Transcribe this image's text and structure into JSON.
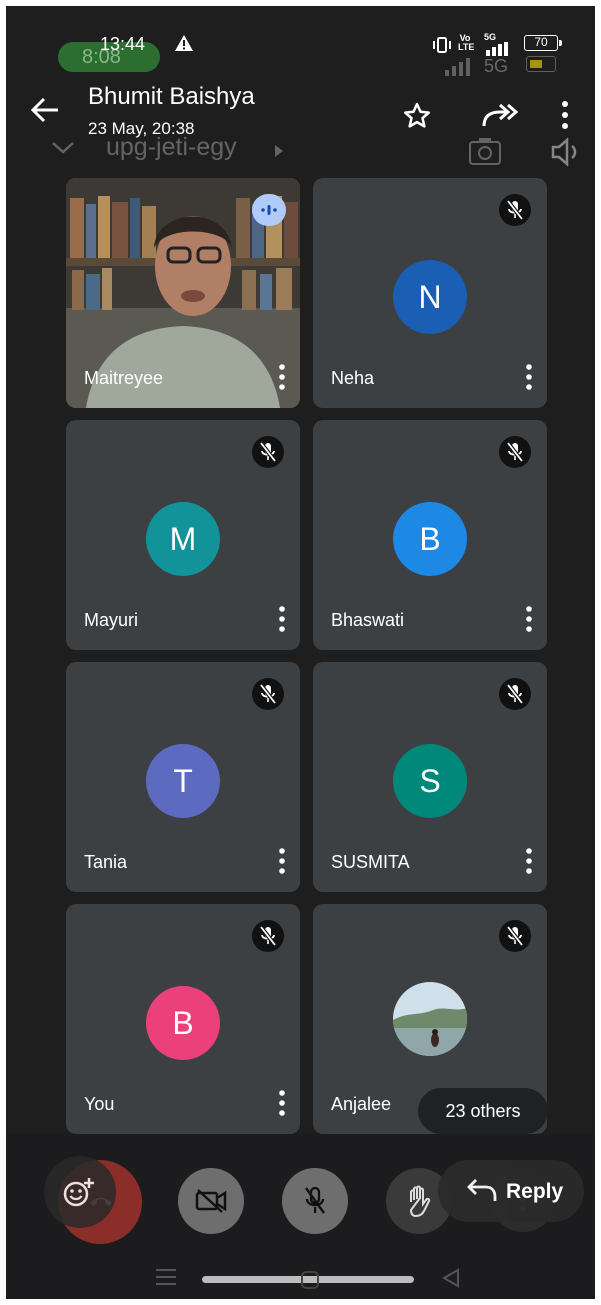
{
  "status_bar": {
    "time": "13:44",
    "battery": "70",
    "ghost_time": "8:08",
    "ghost_network": "5G",
    "volte": "Vo LTE",
    "network": "5G"
  },
  "header": {
    "title": "Bhumit Baishya",
    "subtitle": "23 May, 20:38",
    "ghost_meeting_code": "upg-jeti-egy"
  },
  "participants": [
    {
      "name": "Maitreyee",
      "initial": "",
      "color": "",
      "video": true,
      "speaking": true,
      "muted": false
    },
    {
      "name": "Neha",
      "initial": "N",
      "color": "#1a5fb4",
      "muted": true
    },
    {
      "name": "Mayuri",
      "initial": "M",
      "color": "#12939a",
      "muted": true
    },
    {
      "name": "Bhaswati",
      "initial": "B",
      "color": "#1e88e5",
      "muted": true
    },
    {
      "name": "Tania",
      "initial": "T",
      "color": "#5c6bc0",
      "muted": true
    },
    {
      "name": "SUSMITA",
      "initial": "S",
      "color": "#00897b",
      "muted": true
    },
    {
      "name": "You",
      "initial": "B",
      "color": "#ec407a",
      "muted": true
    },
    {
      "name": "Anjalee",
      "initial": "",
      "color": "",
      "photo": true,
      "muted": true
    }
  ],
  "others": "23 others",
  "reply_label": "Reply",
  "icons": [
    "back-arrow-icon",
    "star-icon",
    "forward-icon",
    "more-vert-icon",
    "mic-off-icon",
    "audio-wave-icon",
    "emoji-add-icon",
    "end-call-icon",
    "camera-off-icon",
    "hand-raise-icon",
    "reply-icon"
  ]
}
